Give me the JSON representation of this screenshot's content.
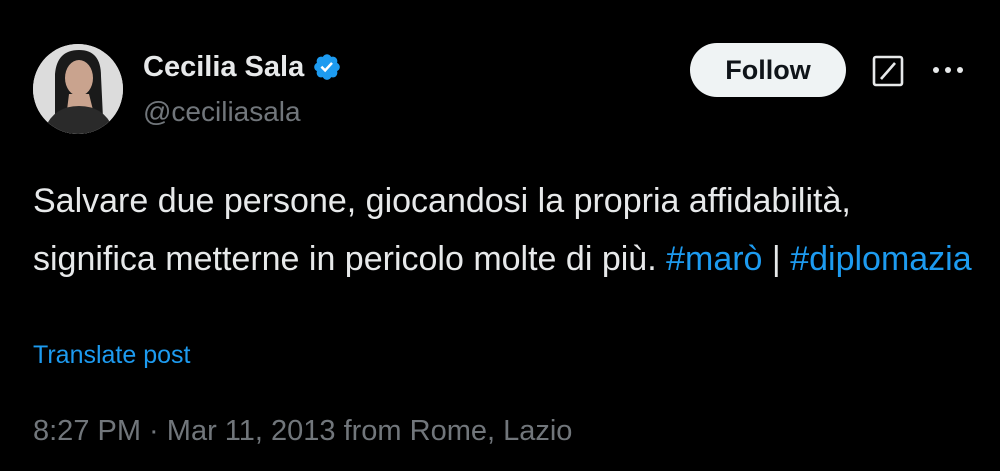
{
  "author": {
    "display_name": "Cecilia Sala",
    "handle": "@ceciliasala",
    "verified_icon": "verified-badge-icon"
  },
  "actions": {
    "follow_label": "Follow",
    "grok_icon": "grok-icon",
    "more_icon": "more-options-icon"
  },
  "tweet": {
    "text_part1": "Salvare due persone, giocandosi la propria affidabilità, significa metterne in pericolo molte di più. ",
    "hashtag1": "#marò",
    "separator": " | ",
    "hashtag2": "#diplomazia",
    "translate_label": "Translate post"
  },
  "meta": {
    "time": "8:27 PM",
    "dot": " · ",
    "date": "Mar 11, 2013",
    "location_text": " from Rome, Lazio"
  },
  "colors": {
    "background": "#000000",
    "text": "#e7e9ea",
    "secondary": "#71767b",
    "accent": "#1d9bf0"
  }
}
